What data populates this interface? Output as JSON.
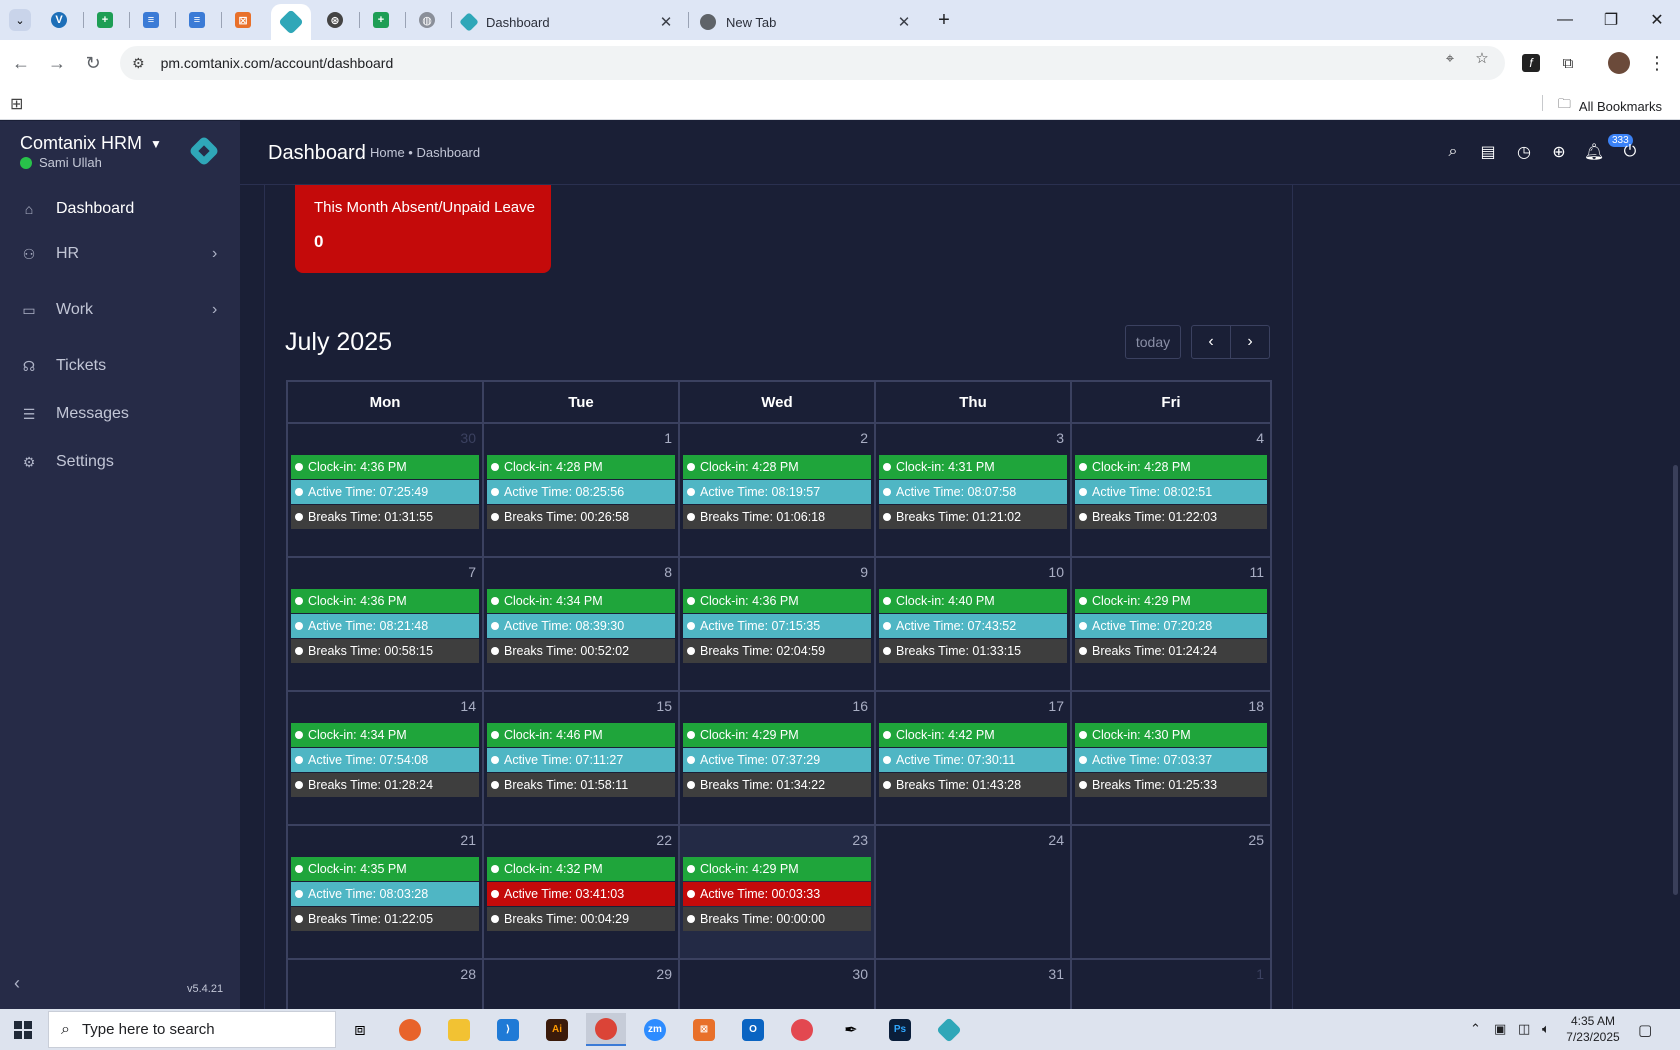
{
  "browser": {
    "tabs": [
      {
        "title": "Dashboard",
        "close": "✕"
      },
      {
        "title": "New Tab",
        "close": "✕"
      }
    ],
    "url": "pm.comtanix.com/account/dashboard",
    "all_bookmarks": "All Bookmarks"
  },
  "sidebar": {
    "brand": "Comtanix HRM",
    "user": "Sami Ullah",
    "items": [
      {
        "label": "Dashboard",
        "icon": "home-icon"
      },
      {
        "label": "HR",
        "icon": "users-icon"
      },
      {
        "label": "Work",
        "icon": "briefcase-icon"
      },
      {
        "label": "Tickets",
        "icon": "headset-icon"
      },
      {
        "label": "Messages",
        "icon": "message-icon"
      },
      {
        "label": "Settings",
        "icon": "gear-icon"
      }
    ],
    "version": "v5.4.21"
  },
  "header": {
    "title": "Dashboard",
    "breadcrumb": "Home • Dashboard",
    "notification_count": "333"
  },
  "absent_card": {
    "label": "This Month Absent/Unpaid Leave",
    "value": "0"
  },
  "calendar": {
    "title": "July 2025",
    "today_label": "today",
    "weekdays": [
      "Mon",
      "Tue",
      "Wed",
      "Thu",
      "Fri"
    ],
    "weeks": [
      [
        {
          "day": "30",
          "other": true,
          "clock_in": "Clock-in: 4:36 PM",
          "active": "Active Time: 07:25:49",
          "breaks": "Breaks Time: 01:31:55"
        },
        {
          "day": "1",
          "clock_in": "Clock-in: 4:28 PM",
          "active": "Active Time: 08:25:56",
          "breaks": "Breaks Time: 00:26:58"
        },
        {
          "day": "2",
          "clock_in": "Clock-in: 4:28 PM",
          "active": "Active Time: 08:19:57",
          "breaks": "Breaks Time: 01:06:18"
        },
        {
          "day": "3",
          "clock_in": "Clock-in: 4:31 PM",
          "active": "Active Time: 08:07:58",
          "breaks": "Breaks Time: 01:21:02"
        },
        {
          "day": "4",
          "clock_in": "Clock-in: 4:28 PM",
          "active": "Active Time: 08:02:51",
          "breaks": "Breaks Time: 01:22:03"
        }
      ],
      [
        {
          "day": "7",
          "clock_in": "Clock-in: 4:36 PM",
          "active": "Active Time: 08:21:48",
          "breaks": "Breaks Time: 00:58:15"
        },
        {
          "day": "8",
          "clock_in": "Clock-in: 4:34 PM",
          "active": "Active Time: 08:39:30",
          "breaks": "Breaks Time: 00:52:02"
        },
        {
          "day": "9",
          "clock_in": "Clock-in: 4:36 PM",
          "active": "Active Time: 07:15:35",
          "breaks": "Breaks Time: 02:04:59"
        },
        {
          "day": "10",
          "clock_in": "Clock-in: 4:40 PM",
          "active": "Active Time: 07:43:52",
          "breaks": "Breaks Time: 01:33:15"
        },
        {
          "day": "11",
          "clock_in": "Clock-in: 4:29 PM",
          "active": "Active Time: 07:20:28",
          "breaks": "Breaks Time: 01:24:24"
        }
      ],
      [
        {
          "day": "14",
          "clock_in": "Clock-in: 4:34 PM",
          "active": "Active Time: 07:54:08",
          "breaks": "Breaks Time: 01:28:24"
        },
        {
          "day": "15",
          "clock_in": "Clock-in: 4:46 PM",
          "active": "Active Time: 07:11:27",
          "breaks": "Breaks Time: 01:58:11"
        },
        {
          "day": "16",
          "clock_in": "Clock-in: 4:29 PM",
          "active": "Active Time: 07:37:29",
          "breaks": "Breaks Time: 01:34:22"
        },
        {
          "day": "17",
          "clock_in": "Clock-in: 4:42 PM",
          "active": "Active Time: 07:30:11",
          "breaks": "Breaks Time: 01:43:28"
        },
        {
          "day": "18",
          "clock_in": "Clock-in: 4:30 PM",
          "active": "Active Time: 07:03:37",
          "breaks": "Breaks Time: 01:25:33"
        }
      ],
      [
        {
          "day": "21",
          "clock_in": "Clock-in: 4:35 PM",
          "active": "Active Time: 08:03:28",
          "breaks": "Breaks Time: 01:22:05"
        },
        {
          "day": "22",
          "clock_in": "Clock-in: 4:32 PM",
          "active": "Active Time: 03:41:03",
          "active_status": "red",
          "breaks": "Breaks Time: 00:04:29"
        },
        {
          "day": "23",
          "today": true,
          "clock_in": "Clock-in: 4:29 PM",
          "active": "Active Time: 00:03:33",
          "active_status": "red",
          "breaks": "Breaks Time: 00:00:00"
        },
        {
          "day": "24"
        },
        {
          "day": "25"
        }
      ],
      [
        {
          "day": "28"
        },
        {
          "day": "29"
        },
        {
          "day": "30"
        },
        {
          "day": "31"
        },
        {
          "day": "1",
          "other": true
        }
      ]
    ]
  },
  "taskbar": {
    "search_placeholder": "Type here to search",
    "time": "4:35 AM",
    "date": "7/23/2025"
  }
}
